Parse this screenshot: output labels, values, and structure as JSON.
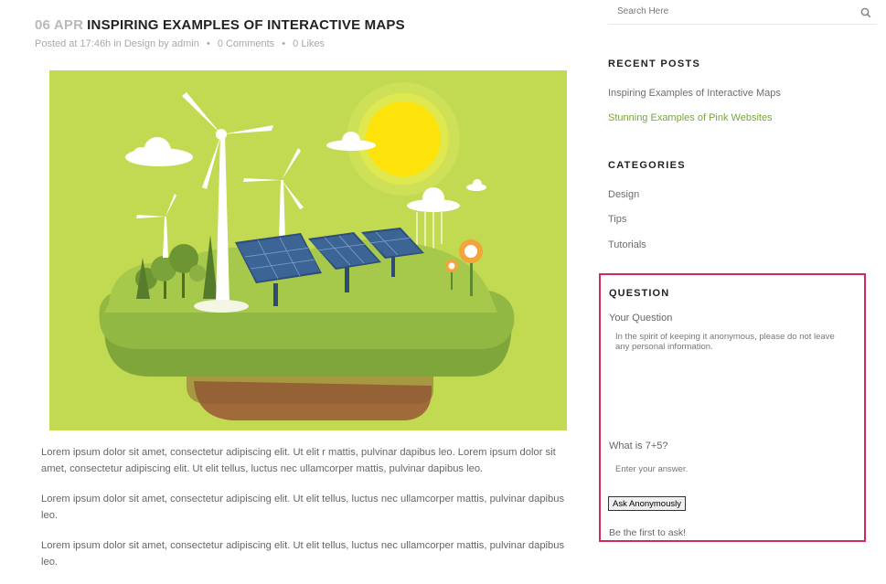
{
  "post": {
    "date": "06 APR",
    "title": "INSPIRING EXAMPLES OF INTERACTIVE MAPS",
    "meta": {
      "posted_prefix": "Posted at 17:46h in",
      "category": "Design",
      "by": "by",
      "author": "admin",
      "comments": "0 Comments",
      "likes": "0 Likes",
      "separator": "•"
    },
    "paragraphs": [
      "Lorem ipsum dolor sit amet, consectetur adipiscing elit. Ut elit r mattis, pulvinar dapibus leo. Lorem ipsum dolor sit amet, consectetur adipiscing elit. Ut elit tellus, luctus nec ullamcorper mattis, pulvinar dapibus leo.",
      "Lorem ipsum dolor sit amet, consectetur adipiscing elit. Ut elit tellus, luctus nec ullamcorper mattis, pulvinar dapibus leo.",
      "Lorem ipsum dolor sit amet, consectetur adipiscing elit. Ut elit tellus, luctus nec ullamcorper mattis, pulvinar dapibus leo."
    ]
  },
  "sidebar": {
    "search": {
      "placeholder": "Search Here",
      "icon": "search-icon"
    },
    "recent_posts": {
      "title": "RECENT POSTS",
      "items": [
        "Inspiring Examples of Interactive Maps",
        "Stunning Examples of Pink Websites"
      ]
    },
    "categories": {
      "title": "CATEGORIES",
      "items": [
        "Design",
        "Tips",
        "Tutorials"
      ]
    },
    "question": {
      "title": "QUESTION",
      "your_question_label": "Your Question",
      "textarea_placeholder": "In the spirit of keeping it anonymous, please do not leave any personal information.",
      "captcha_label": "What is 7+5?",
      "answer_placeholder": "Enter your answer.",
      "button_label": "Ask Anonymously",
      "empty_text": "Be the first to ask!"
    }
  },
  "colors": {
    "accent_green": "#7aa33c",
    "highlight_border": "#d4285a",
    "illustration_bg": "#c2d952"
  }
}
